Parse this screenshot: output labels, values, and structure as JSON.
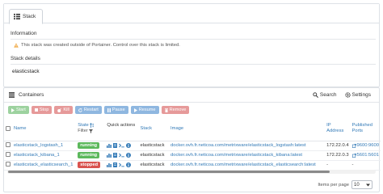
{
  "tab": {
    "label": "Stack",
    "icon": "list-icon"
  },
  "information": {
    "heading": "Information",
    "notice": "This stack was created outside of Portainer. Control over this stack is limited.",
    "notice_icon": "warning-icon"
  },
  "stack_details": {
    "heading": "Stack details",
    "name": "elasticstack"
  },
  "containers": {
    "heading": "Containers",
    "search_label": "Search",
    "settings_label": "Settings",
    "actions": [
      {
        "label": "Start",
        "icon": "play-icon",
        "color": "#9dd29f"
      },
      {
        "label": "Stop",
        "icon": "stop-icon",
        "color": "#e69a9a"
      },
      {
        "label": "Kill",
        "icon": "bomb-icon",
        "color": "#e69a9a"
      },
      {
        "label": "Restart",
        "icon": "refresh-icon",
        "color": "#8fb7e0"
      },
      {
        "label": "Pause",
        "icon": "pause-icon",
        "color": "#8fb7e0"
      },
      {
        "label": "Resume",
        "icon": "play-icon",
        "color": "#8fb7e0"
      },
      {
        "label": "Remove",
        "icon": "trash-icon",
        "color": "#e69a9a"
      }
    ],
    "columns": {
      "name": "Name",
      "state": "State",
      "filter": "Filter",
      "quick_actions": "Quick actions",
      "stack": "Stack",
      "image": "Image",
      "ip": "IP Address",
      "ports": "Published Ports"
    },
    "rows": [
      {
        "name": "elasticstack_logstash_1",
        "state": "running",
        "state_color": "#5cb85c",
        "stack": "elasticstack",
        "image": "docker.ovh.fr.neticoa.com/metrixware/elasticstack_logstash:latest",
        "ip": "172.22.0.4",
        "port": "9600:9600"
      },
      {
        "name": "elasticstack_kibana_1",
        "state": "running",
        "state_color": "#5cb85c",
        "stack": "elasticstack",
        "image": "docker.ovh.fr.neticoa.com/metrixware/elasticstack_kibana:latest",
        "ip": "172.22.0.3",
        "port": "5601:5601"
      },
      {
        "name": "elasticstack_elasticsearch_1",
        "state": "stopped",
        "state_color": "#d9534f",
        "stack": "elasticstack",
        "image": "docker.ovh.fr.neticoa.com/metrixware/elasticstack_elasticsearch:latest",
        "ip": "-",
        "port": "-"
      }
    ],
    "pager": {
      "label": "Items per page",
      "value": "10"
    }
  },
  "colors": {
    "link": "#337ab7",
    "running": "#5cb85c",
    "stopped": "#d9534f",
    "border": "#dde1e6"
  }
}
